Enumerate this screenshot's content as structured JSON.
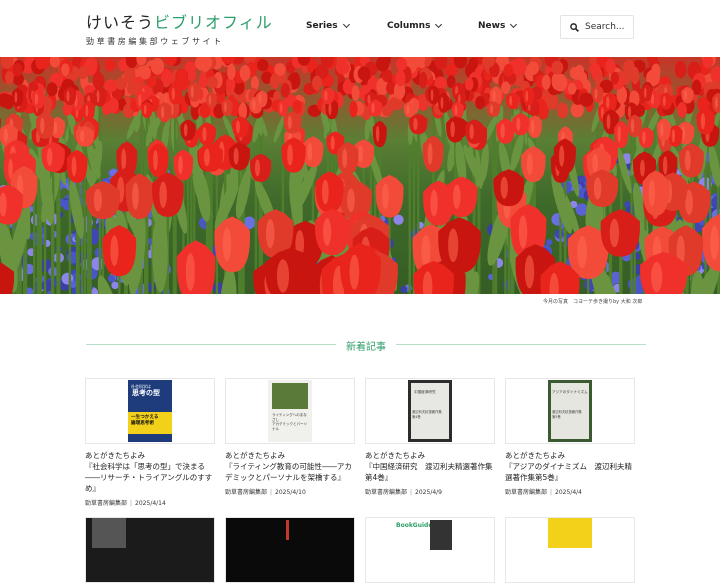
{
  "header": {
    "logo_main": "けいそう",
    "logo_accent": "ビブリオフィル",
    "logo_sub": "勁草書房編集部ウェブサイト",
    "nav": [
      {
        "label": "Series"
      },
      {
        "label": "Columns"
      },
      {
        "label": "News"
      }
    ],
    "search_placeholder": "Search..."
  },
  "hero": {
    "caption": "今月の写真　コヨーテ歩き撮りby 大和 次郎"
  },
  "section": {
    "title": "新着記事"
  },
  "cards": [
    {
      "title": "あとがきたちよみ\n『社会科学は「思考の型」で決まる――リサーチ・トライアングルのすすめ』",
      "author": "勁草書房編集部",
      "date": "2025/4/14",
      "cover": {
        "tag": "社会科学は",
        "big": "思考の型",
        "band": "一生つかえる\n論理思考術"
      }
    },
    {
      "title": "あとがきたちよみ\n『ライティング教育の可能性――アカデミックとパーソナルを架橋する』",
      "author": "勁草書房編集部",
      "date": "2025/4/10",
      "cover": {
        "text": "ライティングへのまなざし\nアカデミックとパーソナル"
      }
    },
    {
      "title": "あとがきたちよみ\n『中国経済研究　渡辺利夫精選著作集 第4巻』",
      "author": "勁草書房編集部",
      "date": "2025/4/9",
      "cover": {
        "t1": "中国経済研究",
        "t2": "渡辺利夫精選著作集\n第4巻"
      }
    },
    {
      "title": "あとがきたちよみ\n『アジアのダイナミズム　渡辺利夫精選著作集第5巻』",
      "author": "勁草書房編集部",
      "date": "2025/4/4",
      "cover": {
        "t1": "アジアのダイナミズム",
        "t2": "渡辺利夫精選著作集\n第5巻"
      }
    }
  ],
  "next_row": [
    {
      "label": ""
    },
    {
      "label": ""
    },
    {
      "label": "BookGuide for"
    },
    {
      "label": ""
    }
  ],
  "colors": {
    "accent": "#2e9e6a",
    "tulip": "#e8241c",
    "pansy": "#4a55c8",
    "cover_blue": "#1e3c7c",
    "cover_yellow": "#f3d11a"
  },
  "icons": {
    "search": "search-icon",
    "chevron": "chevron-down-icon"
  }
}
